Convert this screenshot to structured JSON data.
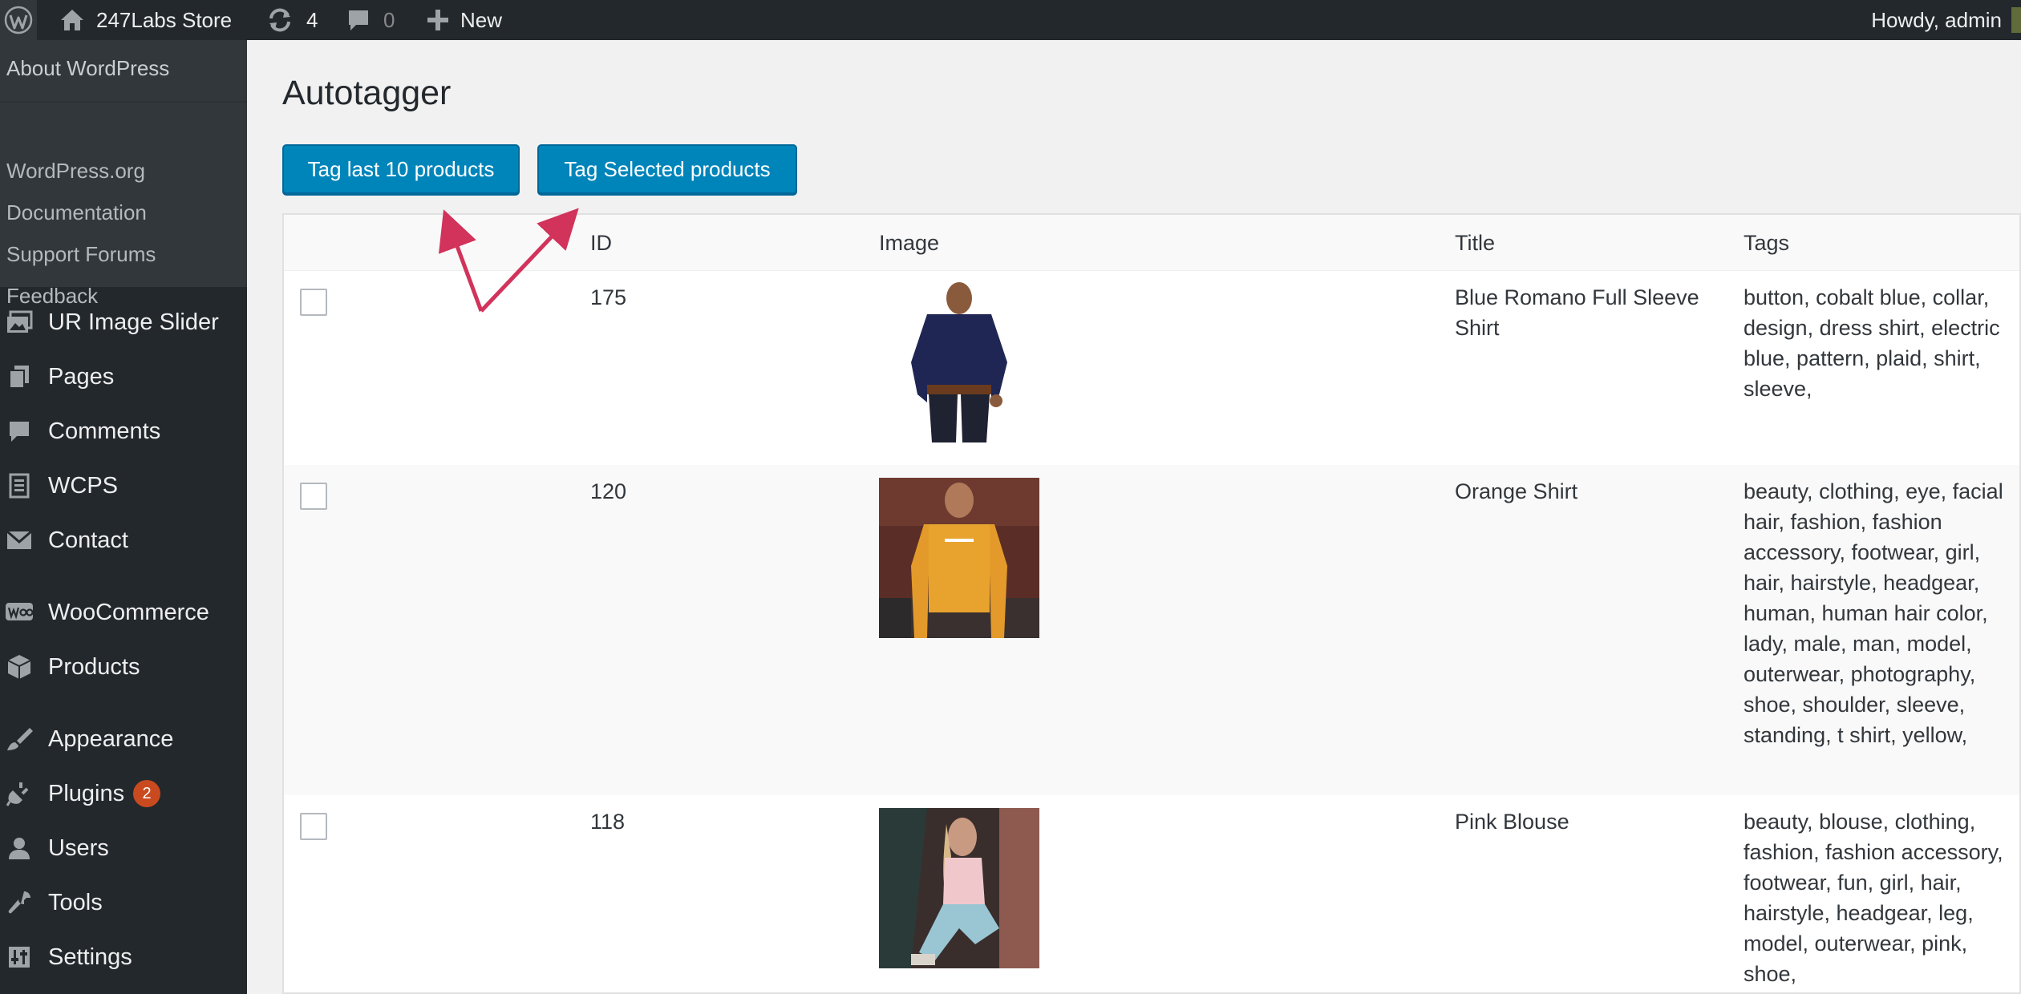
{
  "admin_bar": {
    "wp_logo_icon": "wordpress-logo-icon",
    "site_name": "247Labs Store",
    "updates_count": "4",
    "comments_count": "0",
    "new_label": "New",
    "account_greeting": "Howdy, admin"
  },
  "sidebar": {
    "about": "About WordPress",
    "about_submenu": [
      "WordPress.org",
      "Documentation",
      "Support Forums",
      "Feedback"
    ],
    "items": [
      {
        "label": "UR Image Slider",
        "icon": "image-slider-icon"
      },
      {
        "label": "Pages",
        "icon": "pages-icon"
      },
      {
        "label": "Comments",
        "icon": "comments-icon"
      },
      {
        "label": "WCPS",
        "icon": "wcps-icon"
      },
      {
        "label": "Contact",
        "icon": "mail-icon"
      },
      {
        "label": "WooCommerce",
        "icon": "woo-icon"
      },
      {
        "label": "Products",
        "icon": "products-icon"
      },
      {
        "label": "Appearance",
        "icon": "brush-icon"
      },
      {
        "label": "Plugins",
        "icon": "plugin-icon",
        "badge": "2"
      },
      {
        "label": "Users",
        "icon": "user-icon"
      },
      {
        "label": "Tools",
        "icon": "wrench-icon"
      },
      {
        "label": "Settings",
        "icon": "settings-icon"
      }
    ]
  },
  "main": {
    "title": "Autotagger",
    "buttons": {
      "tag_last": "Tag last 10 products",
      "tag_selected": "Tag Selected products"
    },
    "table": {
      "headers": {
        "id": "ID",
        "image": "Image",
        "title": "Title",
        "tags": "Tags"
      },
      "rows": [
        {
          "id": "175",
          "title": "Blue Romano Full Sleeve Shirt",
          "tags": "button, cobalt blue, collar, design, dress shirt, electric blue, pattern, plaid, shirt, sleeve,",
          "image": "blue-shirt-photo",
          "checked": false
        },
        {
          "id": "120",
          "title": "Orange Shirt",
          "tags": "beauty, clothing, eye, facial hair, fashion, fashion accessory, footwear, girl, hair, hairstyle, headgear, human, human hair color, lady, male, man, model, outerwear, photography, shoe, shoulder, sleeve, standing, t shirt, yellow,",
          "image": "orange-shirt-photo",
          "checked": false
        },
        {
          "id": "118",
          "title": "Pink Blouse",
          "tags": "beauty, blouse, clothing, fashion, fashion accessory, footwear, fun, girl, hair, hairstyle, headgear, leg, model, outerwear, pink, shoe,",
          "image": "pink-blouse-photo",
          "checked": false
        }
      ]
    }
  },
  "colors": {
    "admin_bg": "#23282d",
    "button_primary": "#0085ba",
    "annotation_arrow": "#d1335b",
    "badge": "#ca4a1f"
  }
}
